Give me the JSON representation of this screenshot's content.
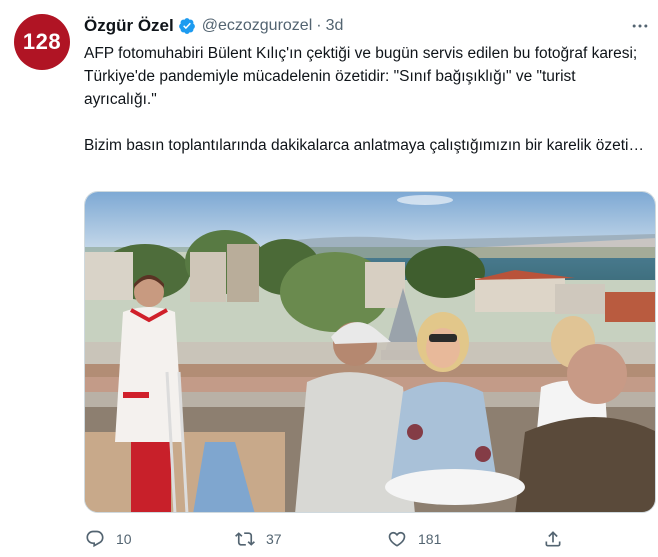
{
  "avatar": {
    "text": "128",
    "color": "#b01424"
  },
  "author": {
    "name": "Özgür Özel",
    "verified_icon": "verified-badge-icon",
    "handle": "@eczozgurozel",
    "separator": "·",
    "time": "3d"
  },
  "tweet": {
    "paragraph1": "AFP fotomuhabiri Bülent Kılıç'ın çektiği ve bugün servis edilen bu fotoğraf karesi; Türkiye'de pandemiyle mücadelenin özetidir: \"Sınıf bağışıklığı\" ve \"turist ayrıcalığı.\"",
    "paragraph2": "Bizim basın toplantılarında dakikalarca anlatmaya çalıştığımızın bir karelik özeti…"
  },
  "actions": {
    "reply": {
      "icon": "reply-icon",
      "count": "10"
    },
    "retweet": {
      "icon": "retweet-icon",
      "count": "37"
    },
    "like": {
      "icon": "heart-icon",
      "count": "181"
    },
    "share": {
      "icon": "share-icon"
    }
  },
  "colors": {
    "accent": "#1d9bf0",
    "secondary_text": "#536471",
    "primary_text": "#0f1419"
  }
}
